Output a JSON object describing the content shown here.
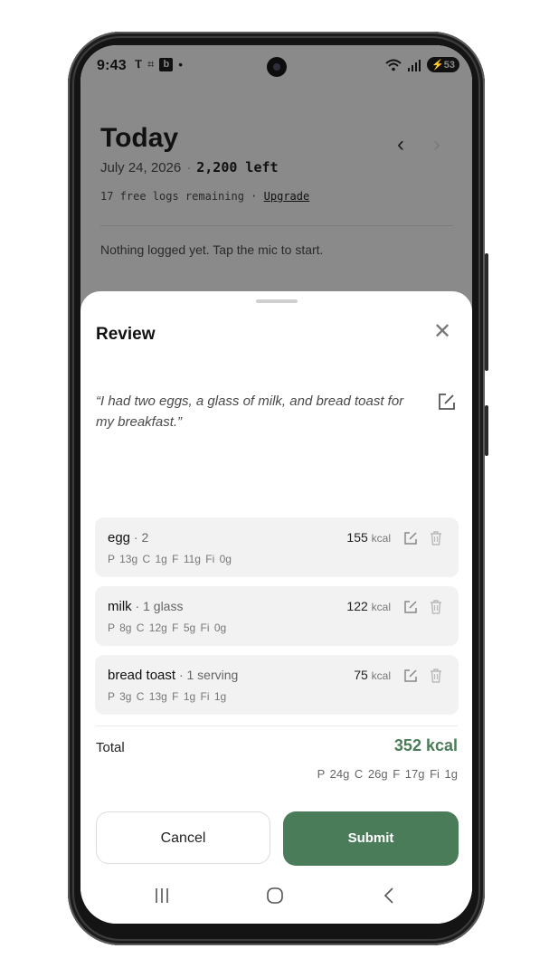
{
  "status_bar": {
    "time": "9:43",
    "icons": [
      "signal-antenna-icon",
      "nfc-icon",
      "b-app-icon",
      "dot-icon"
    ],
    "battery": "53"
  },
  "background": {
    "title": "Today",
    "date": "July 24, 2026",
    "calories_left": "2,200 left",
    "logs_remaining": "17 free logs remaining",
    "upgrade_label": "Upgrade",
    "empty_message": "Nothing logged yet. Tap the mic to start."
  },
  "review": {
    "title": "Review",
    "transcript": "“I had two eggs, a glass of milk, and bread toast for my breakfast.”",
    "items": [
      {
        "name": "egg",
        "qty": " · 2",
        "kcal": "155",
        "unit": "kcal",
        "macros": "P 13g  C 1g  F 11g  Fi 0g"
      },
      {
        "name": "milk",
        "qty": " · 1 glass",
        "kcal": "122",
        "unit": "kcal",
        "macros": "P 8g  C 12g  F 5g  Fi 0g"
      },
      {
        "name": "bread toast",
        "qty": " · 1 serving",
        "kcal": "75",
        "unit": "kcal",
        "macros": "P 3g  C 13g  F 1g  Fi 1g"
      }
    ],
    "total_label": "Total",
    "total_kcal": "352 kcal",
    "total_macros": "P 24g  C 26g  F 17g  Fi 1g",
    "cancel_label": "Cancel",
    "submit_label": "Submit"
  },
  "colors": {
    "accent": "#4a7c59",
    "card": "#f2f2f2",
    "overlay": "#8a8a8a"
  }
}
